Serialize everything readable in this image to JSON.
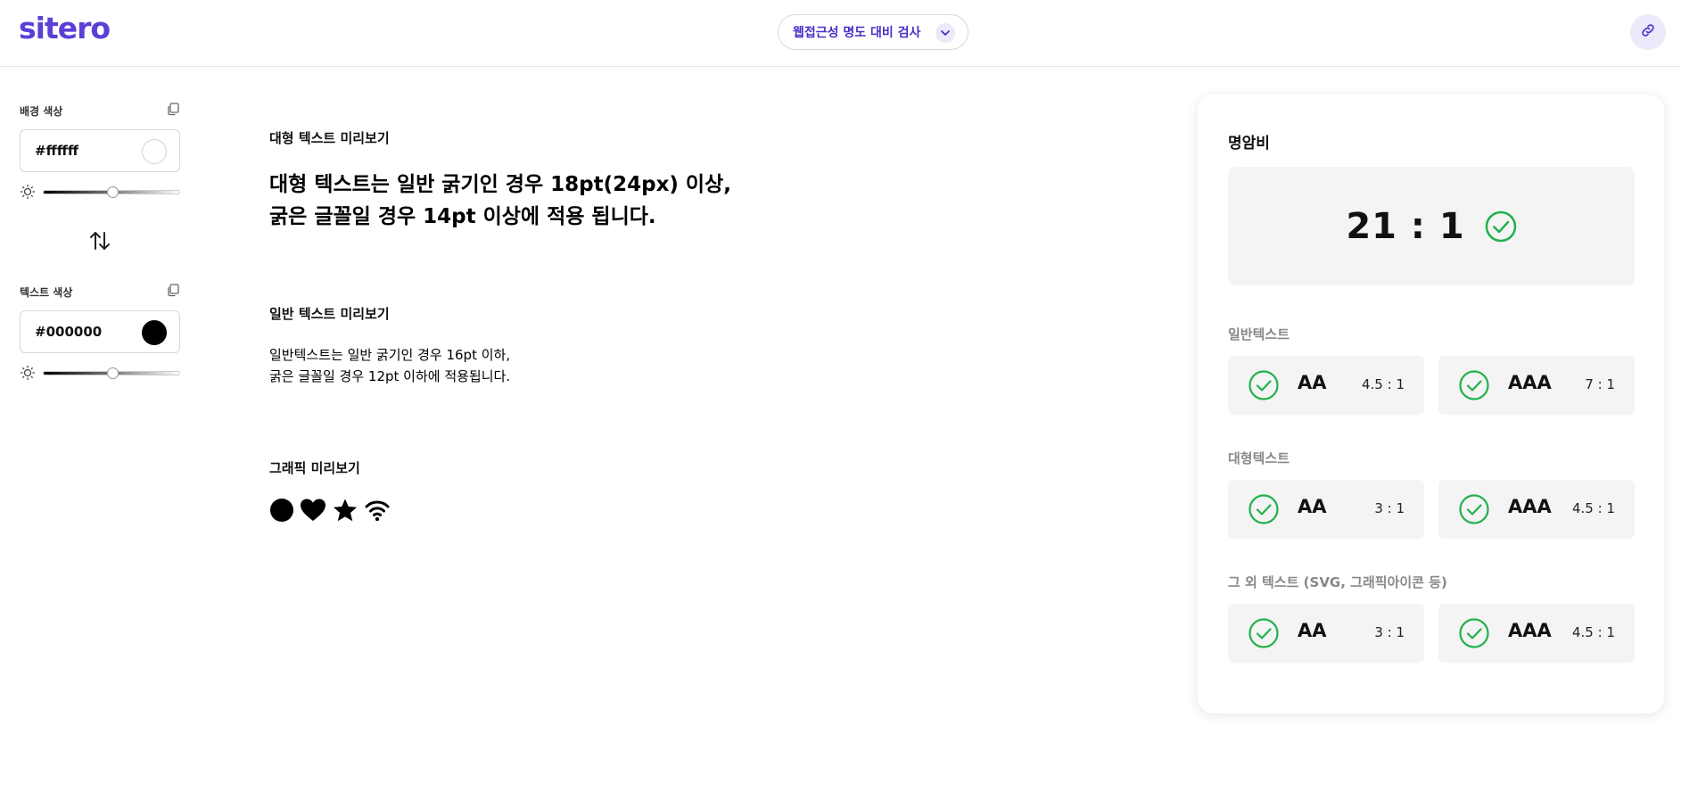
{
  "app": {
    "logo": "sitero"
  },
  "header": {
    "tool_select_label": "웹접근성 명도 대비 검사"
  },
  "sidebar": {
    "background": {
      "label": "배경 색상",
      "value": "#ffffff",
      "swatch_color": "#ffffff"
    },
    "text": {
      "label": "텍스트 색상",
      "value": "#000000",
      "swatch_color": "#000000"
    }
  },
  "preview": {
    "large": {
      "title": "대형 텍스트 미리보기",
      "line1": "대형 텍스트는 일반 굵기인 경우 18pt(24px) 이상,",
      "line2": "굵은 글꼴일 경우 14pt 이상에 적용 됩니다."
    },
    "normal": {
      "title": "일반 텍스트 미리보기",
      "line1": "일반텍스트는 일반 굵기인 경우 16pt 이하,",
      "line2": "굵은 글꼴일 경우 12pt 이하에 적용됩니다."
    },
    "graphic": {
      "title": "그래픽 미리보기",
      "icons": [
        "circle-icon",
        "heart-icon",
        "star-icon",
        "wifi-icon"
      ]
    }
  },
  "results": {
    "title": "명암비",
    "ratio": "21 : 1",
    "pass_color": "#22b14c",
    "groups": [
      {
        "label": "일반텍스트",
        "items": [
          {
            "level": "AA",
            "req": "4.5 : 1"
          },
          {
            "level": "AAA",
            "req": "7 : 1"
          }
        ]
      },
      {
        "label": "대형텍스트",
        "items": [
          {
            "level": "AA",
            "req": "3 : 1"
          },
          {
            "level": "AAA",
            "req": "4.5 : 1"
          }
        ]
      },
      {
        "label": "그 외 텍스트 (SVG, 그래픽아이콘 등)",
        "items": [
          {
            "level": "AA",
            "req": "3 : 1"
          },
          {
            "level": "AAA",
            "req": "4.5 : 1"
          }
        ]
      }
    ]
  },
  "colors": {
    "brand": "#5b3fd6",
    "accent_bg": "#ece9fb",
    "panel_bg": "#f4f4f4"
  }
}
